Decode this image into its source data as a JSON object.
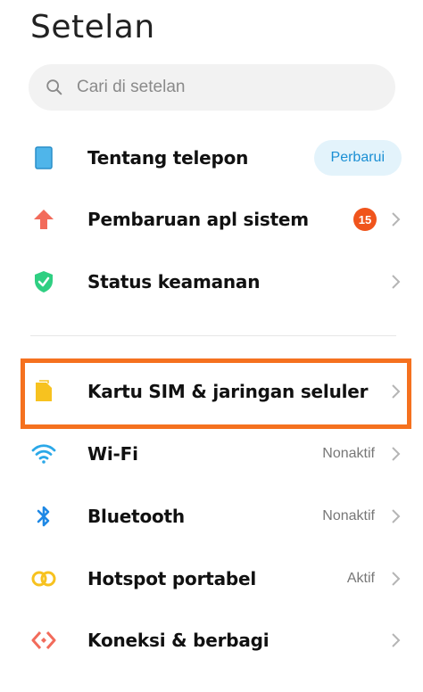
{
  "header": {
    "title": "Setelan"
  },
  "search": {
    "placeholder": "Cari di setelan"
  },
  "sections": {
    "device": [
      {
        "label": "Tentang telepon",
        "icon": "phone-icon",
        "action": "Perbarui"
      },
      {
        "label": "Pembaruan apl sistem",
        "icon": "arrow-up-icon",
        "badge": "15"
      },
      {
        "label": "Status keamanan",
        "icon": "shield-check-icon"
      }
    ],
    "network": [
      {
        "label": "Kartu SIM & jaringan seluler",
        "icon": "sim-card-icon"
      },
      {
        "label": "Wi-Fi",
        "icon": "wifi-icon",
        "value": "Nonaktif"
      },
      {
        "label": "Bluetooth",
        "icon": "bluetooth-icon",
        "value": "Nonaktif"
      },
      {
        "label": "Hotspot portabel",
        "icon": "hotspot-icon",
        "value": "Aktif"
      },
      {
        "label": "Koneksi & berbagi",
        "icon": "connection-sharing-icon"
      }
    ]
  },
  "colors": {
    "highlight": "#f5711f",
    "badge": "#f0541c",
    "pill_bg": "#e3f3fb",
    "pill_text": "#1a8fd4",
    "phone_icon": "#4fb5ea",
    "update_icon": "#f26b5b",
    "shield_icon": "#2fcf82",
    "sim_icon": "#f7c21f",
    "wifi_icon": "#2ba8e8",
    "bluetooth_icon": "#1e88e5",
    "hotspot_icon": "#f7c21f",
    "connection_icon": "#f26b5b"
  }
}
